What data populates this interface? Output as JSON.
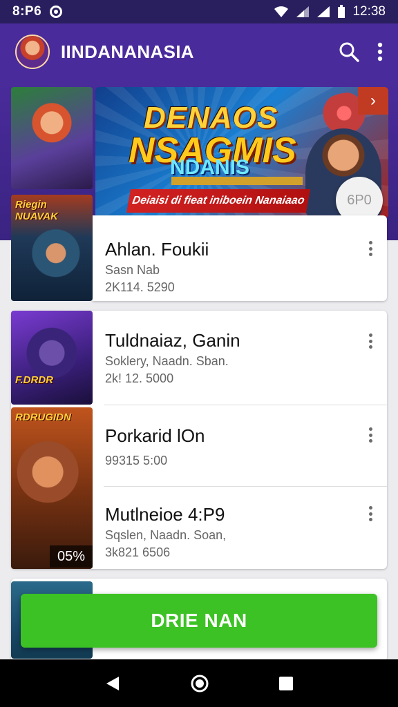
{
  "status_bar": {
    "time": "8:P6",
    "clock": "12:38"
  },
  "app_bar": {
    "title": "IINDANANASIA"
  },
  "banner": {
    "line1": "DENAOS",
    "line2": "NSAGMIS",
    "line3": "NDANIS",
    "strip": "Deiaisi di fieat iniboein Nanaiaao"
  },
  "fab_badge": "6P0",
  "list": [
    {
      "title": "Ahlan. Foukii",
      "subtitle": "Sasn Nab",
      "meta": "2K114. 5290",
      "thumb_label": "Riegin NUAVAK"
    },
    {
      "title": "Tuldnaiaz, Ganin",
      "subtitle": "Soklery, Naadn. Sban.",
      "meta": "2k! 12. 5000",
      "thumb_label": "F.DRDR"
    },
    {
      "title": "Porkarid lOn",
      "subtitle": "",
      "meta": "99315 5:00",
      "thumb_label": "RDRUGIDN"
    },
    {
      "title": "Mutlneioe 4:P9",
      "subtitle": "Sqslen, Naadn. Soan,",
      "meta": "3k821 6506",
      "thumb_label": ""
    }
  ],
  "percent_badge": "05%",
  "cta": {
    "label": "DRIE NAN"
  },
  "colors": {
    "primary": "#4a2b9b",
    "status_bar": "#2a1f5e",
    "cta": "#3cc224"
  }
}
